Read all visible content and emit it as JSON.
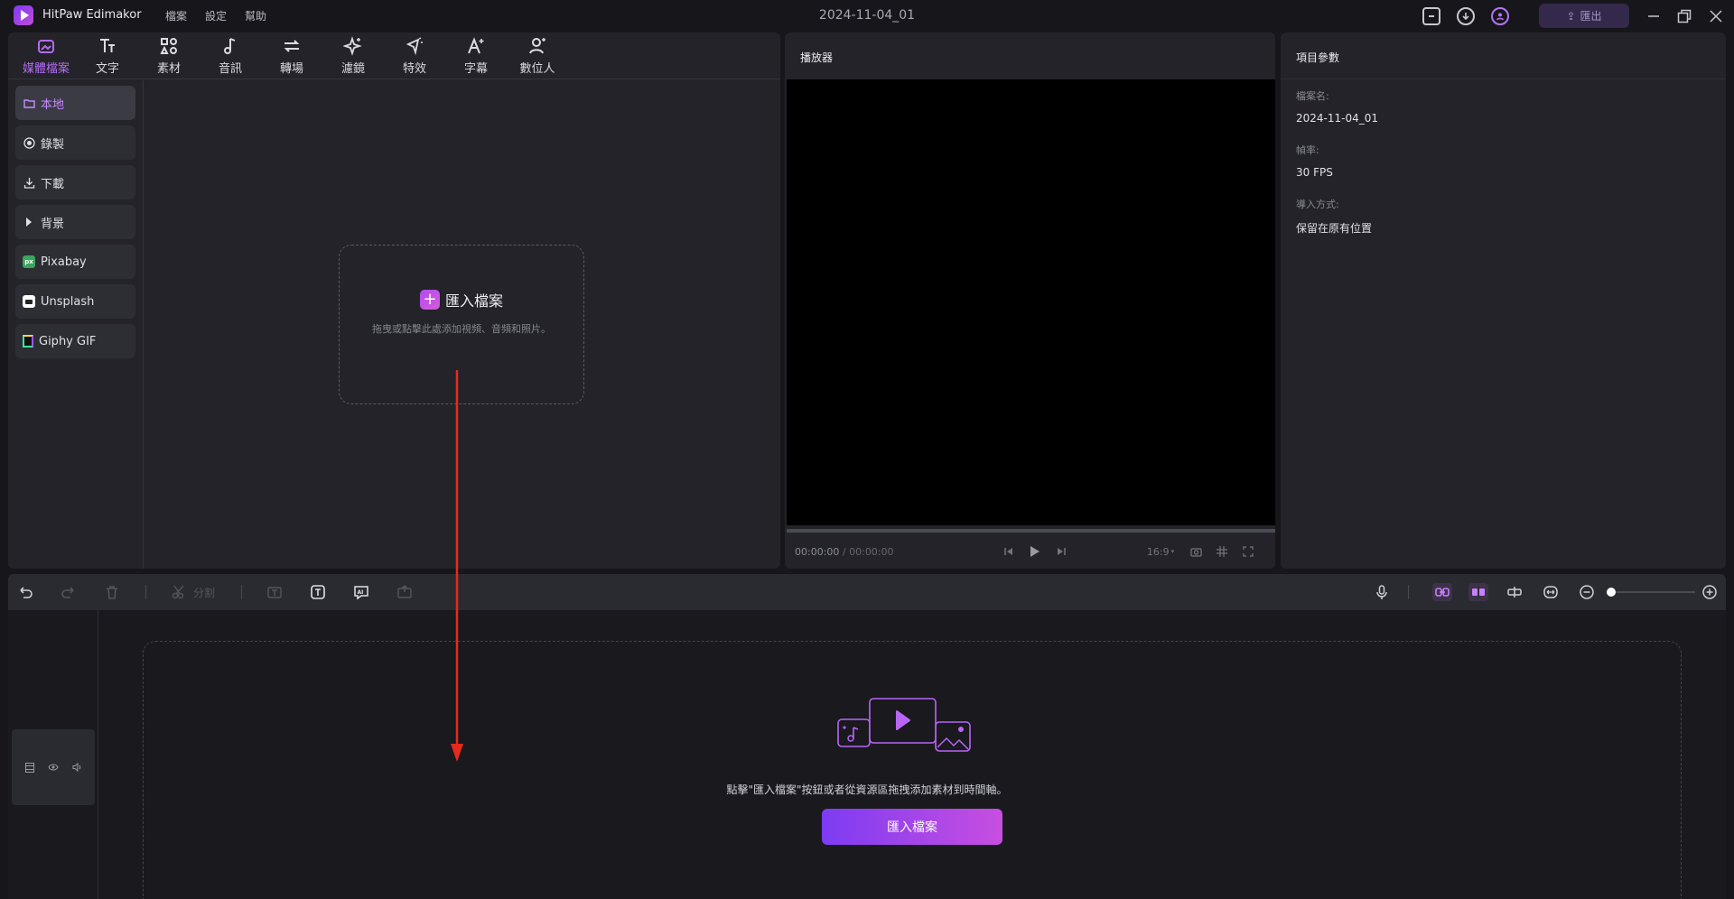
{
  "app": {
    "name": "HitPaw Edimakor",
    "project_title": "2024-11-04_01"
  },
  "menu": [
    "檔案",
    "設定",
    "幫助"
  ],
  "titlebar": {
    "export_label": "匯出"
  },
  "tool_tabs": [
    {
      "label": "媒體檔案",
      "icon": "media-icon"
    },
    {
      "label": "文字",
      "icon": "text-icon"
    },
    {
      "label": "素材",
      "icon": "elements-icon"
    },
    {
      "label": "音訊",
      "icon": "audio-icon"
    },
    {
      "label": "轉場",
      "icon": "transition-icon"
    },
    {
      "label": "濾鏡",
      "icon": "filter-icon"
    },
    {
      "label": "特效",
      "icon": "effects-icon"
    },
    {
      "label": "字幕",
      "icon": "subtitle-icon"
    },
    {
      "label": "數位人",
      "icon": "avatar-icon"
    }
  ],
  "sidebar": {
    "items": [
      {
        "label": "本地",
        "icon": "folder-icon"
      },
      {
        "label": "錄製",
        "icon": "record-icon"
      },
      {
        "label": "下載",
        "icon": "download-icon"
      },
      {
        "label": "背景",
        "icon": "triangle-right-icon"
      },
      {
        "label": "Pixabay",
        "icon": "pixabay-icon"
      },
      {
        "label": "Unsplash",
        "icon": "unsplash-icon"
      },
      {
        "label": "Giphy GIF",
        "icon": "giphy-icon"
      }
    ]
  },
  "media_import": {
    "label": "匯入檔案",
    "hint": "拖曳或點擊此處添加視頻、音頻和照片。"
  },
  "player": {
    "title": "播放器",
    "current_time": "00:00:00",
    "total_time": "00:00:00",
    "aspect": "16:9"
  },
  "params": {
    "title": "項目參數",
    "file_name_label": "檔案名:",
    "file_name": "2024-11-04_01",
    "frame_rate_label": "幀率:",
    "frame_rate": "30 FPS",
    "import_mode_label": "導入方式:",
    "import_mode": "保留在原有位置"
  },
  "timeline": {
    "split_label": "分割",
    "drop_hint": "點擊\"匯入檔案\"按鈕或者從資源區拖拽添加素材到時間軸。",
    "import_button": "匯入檔案",
    "zoom_level": 0.0
  }
}
